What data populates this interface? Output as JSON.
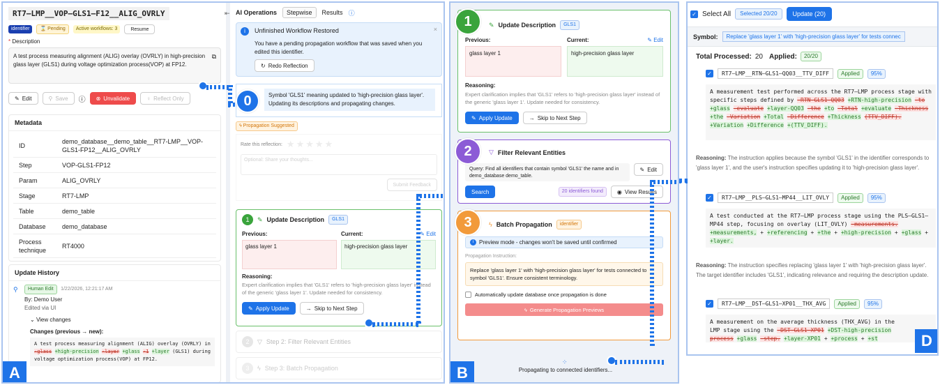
{
  "panelA": {
    "corner": "A",
    "title": "RT7–LMP__VOP–GLS1–F12__ALIG_OVRLY",
    "badges": {
      "identifier": "identifier",
      "pending": "⌛ Pending",
      "active": "Active workflows: 3",
      "resume": "Resume"
    },
    "desc_label": "Description",
    "description": "A test process measuring alignment (ALIG) overlay (OVRLY) in high-precision glass layer (GLS1) during voltage optimization process(VOP) at FP12.",
    "buttons": {
      "edit": "Edit",
      "save": "Save",
      "unvalidate": "Unvalidate",
      "reflect": "Reflect Only"
    },
    "metadata_title": "Metadata",
    "metadata": [
      {
        "k": "ID",
        "v": "demo_database__demo_table__RT7-LMP__VOP-GLS1-FP12__ALIG_OVRLY"
      },
      {
        "k": "Step",
        "v": "VOP-GLS1-FP12"
      },
      {
        "k": "Param",
        "v": "ALIG_OVRLY"
      },
      {
        "k": "Stage",
        "v": "RT7-LMP"
      },
      {
        "k": "Table",
        "v": "demo_table"
      },
      {
        "k": "Database",
        "v": "demo_database"
      },
      {
        "k": "Process technique",
        "v": "RT4000"
      }
    ],
    "history_title": "Update History",
    "history": {
      "tag": "Human Edit",
      "date": "1/22/2026, 12:21:17 AM",
      "by": "By: Demo User",
      "via": "Edited via UI",
      "view": "View changes",
      "changes_title": "Changes (previous → new):"
    },
    "diff": {
      "p1": "A test process measuring alignment (ALIG) overlay (OVRLY) in ",
      "d1": "-glass",
      "a1": "+high-precision",
      "d2": "-layer",
      "a2": "+glass",
      "d3": "-1",
      "a3": "+layer",
      "p2": " (GLS1) during voltage optimization process(VOP) at FP12."
    }
  },
  "ai": {
    "title": "AI Operations",
    "tabs": [
      "Stepwise",
      "Results"
    ],
    "restore_title": "Unfinished Workflow Restored",
    "restore_text": "You have a pending propagation workflow that was saved when you edited this identifier.",
    "redo": "Redo Reflection",
    "zero_num": "0",
    "zero_text": "Symbol 'GLS1' meaning updated to 'high-precision glass layer'. Updating its descriptions and propagating changes.",
    "prop_suggested": "Propagation Suggested",
    "rate": "Rate this reflection:",
    "share_placeholder": "Optional: Share your thoughts...",
    "submit": "Submit Feedback",
    "step1": {
      "num": "1",
      "title": "Update Description",
      "tag": "GLS1",
      "prev_label": "Previous:",
      "cur_label": "Current:",
      "edit": "Edit",
      "prev": "glass layer 1",
      "cur": "high-precision glass layer",
      "reason_label": "Reasoning:",
      "reason": "Expert clarification implies that 'GLS1' refers to 'high-precision glass layer' instead of the generic 'glass layer 1'. Update needed for consistency.",
      "apply": "Apply Update",
      "skip": "Skip to Next Step"
    },
    "step2": {
      "num": "2",
      "title": "Step 2: Filter Relevant Entities"
    },
    "step3": {
      "num": "3",
      "title": "Step 3: Batch Propagation"
    }
  },
  "panelB": {
    "corner": "B",
    "s1": {
      "num": "1",
      "title": "Update Description",
      "tag": "GLS1",
      "prev_label": "Previous:",
      "cur_label": "Current:",
      "edit": "Edit",
      "prev": "glass layer 1",
      "cur": "high-precision glass layer",
      "reason_label": "Reasoning:",
      "reason": "Expert clarification implies that 'GLS1' refers to 'high-precision glass layer' instead of the generic 'glass layer 1'. Update needed for consistency.",
      "apply": "Apply Update",
      "skip": "Skip to Next Step"
    },
    "s2": {
      "num": "2",
      "title": "Filter Relevant Entities",
      "query": "Query: Find all identifiers that contain symbol 'GLS1' the name and in demo_database demo_table.",
      "edit": "Edit",
      "search": "Search",
      "found": "20 identifiers found",
      "view": "View Results"
    },
    "s3": {
      "num": "3",
      "title": "Batch Propagation",
      "tag": "identifier",
      "preview": "Preview mode - changes won't be saved until confirmed",
      "instr_label": "Propagation Instruction:",
      "instr": "Replace 'glass layer 1' with 'high-precision glass layer' for tests connected to symbol 'GLS1'. Ensure consistent terminology.",
      "auto": "Automatically update database once propagation is done",
      "generate": "Generate Propagation Previews"
    },
    "propagating": "Propagating to connected identifiers..."
  },
  "panelD": {
    "corner": "D",
    "select_all": "Select All",
    "selected": "Selected 20/20",
    "update": "Update (20)",
    "symbol_label": "Symbol:",
    "symbol_value": "Replace 'glass layer 1' with 'high-precision glass layer' for tests connec",
    "total_label": "Total Processed:",
    "total": "20",
    "applied_label": "Applied:",
    "applied": "20/20",
    "items": [
      {
        "id": "RT7–LMP__RTN–GLS1–QQ03__TTV_DIFF",
        "status": "Applied",
        "pct": "95%",
        "reason_label": "Reasoning:",
        "reason": "The instruction applies because the symbol 'GLS1' in the identifier corresponds to 'glass layer 1', and the user's instruction specifies updating it to 'high-precision glass layer'."
      },
      {
        "id": "RT7–LMP__PLS–GLS1–MP44__LIT_OVLY",
        "status": "Applied",
        "pct": "95%",
        "reason_label": "Reasoning:",
        "reason": "The instruction specifies replacing 'glass layer 1' with 'high-precision glass layer'. The target identifier includes 'GLS1', indicating relevance and requiring the description update."
      },
      {
        "id": "RT7–LMP__DST–GLS1–XP01__THX_AVG",
        "status": "Applied",
        "pct": "95%"
      }
    ],
    "diff1": {
      "p": "A measurement test performed across the RT7–LMP process stage with specific steps defined by ",
      "d1": "-RTN-GLS1-QQ03",
      "a1": "+RTN-high-precision",
      "d2": "-to",
      "a2": "+glass",
      "d3": "-evaluate",
      "a3": "+layer-QQ03",
      "d4": "-the",
      "a4": "+to",
      "d5": "-Total",
      "a5": "+evaluate",
      "d6": "-Thickness",
      "a6": "+the",
      "d7": "-Variation",
      "a7": "+Total",
      "d8": "-Difference",
      "a8": "+Thickness",
      "d9": "(TTV_DIFF).",
      "a9": "+Variation",
      "a10": "+Difference",
      "a11": "+(TTV_DIFF)."
    },
    "diff2": {
      "p": "A test conducted at the RT7–LMP process stage using the PLS–GLS1–MP44 step, focusing on overlay (LIT_OVLY) ",
      "d1": "-measurements.",
      "a1": "+measurements,",
      "a2": "+referencing",
      "a3": "+the",
      "a4": "+high-precision",
      "a5": "+glass",
      "a6": "+layer."
    },
    "diff3": {
      "p": "A measurement on the average thickness (THX_AVG) in the",
      "p2": "LMP stage using the ",
      "d1": "-DST-GLS1-XP01",
      "a1": "+DST-high-precision",
      "d2": "process",
      "a2": "+glass",
      "d3": "-step.",
      "a3": "+layer-XP01",
      "a4": "+process",
      "a5": "+st"
    }
  }
}
